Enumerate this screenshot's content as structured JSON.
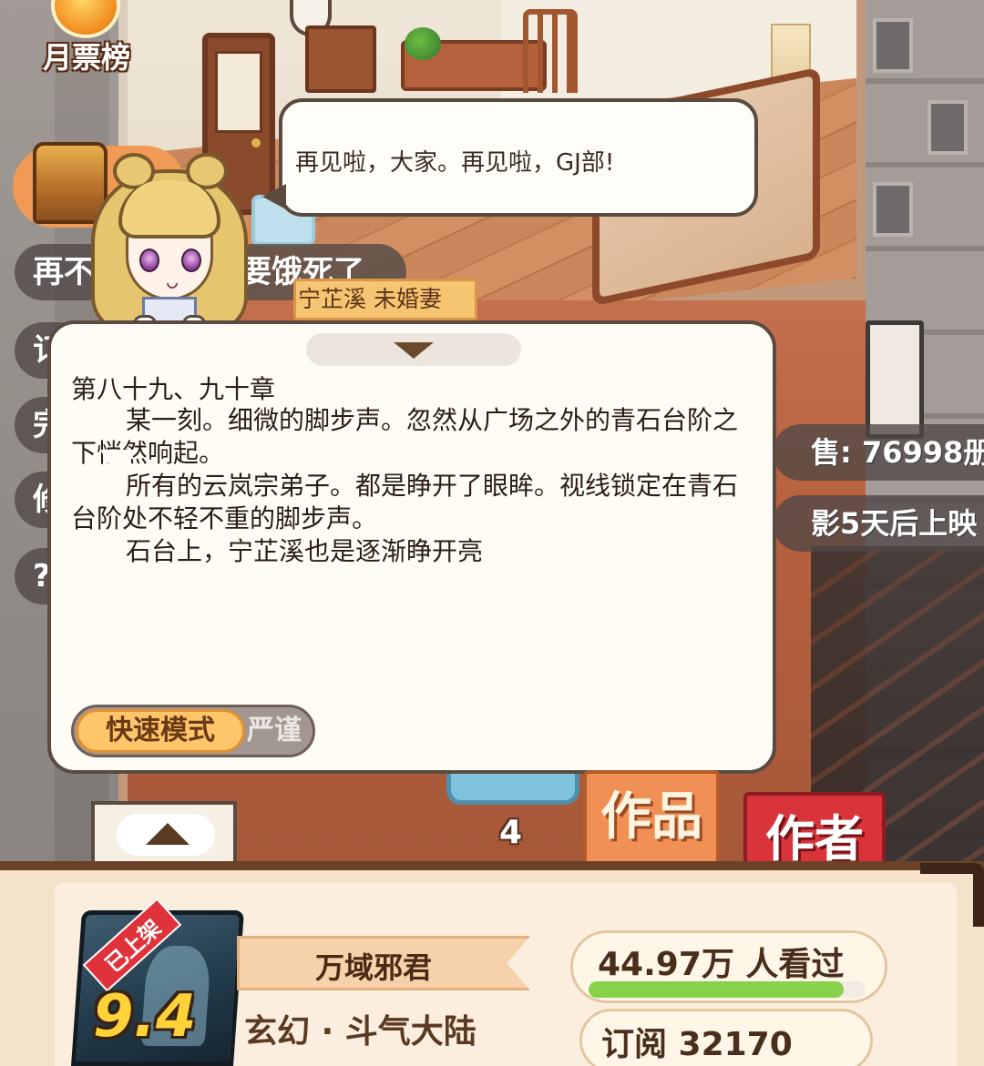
{
  "hud": {
    "monthly_rank_label": "月票榜",
    "left_pills": [
      "再不",
      "要饿死了",
      "订",
      "完",
      "修",
      "?"
    ],
    "right_pills": {
      "sales": "售: 76998册",
      "movie": "影5天后上映"
    }
  },
  "speech": {
    "text": "再见啦，大家。再见啦，GJ部!"
  },
  "name_tag": "宁芷溪  未婚妻",
  "reader": {
    "chapter_title": "第八十九、九十章",
    "paragraphs": [
      "某一刻。细微的脚步声。忽然从广场之外的青石台阶之下悄然响起。",
      "所有的云岚宗弟子。都是睁开了眼眸。视线锁定在青石台阶处不轻不重的脚步声。",
      "石台上，宁芷溪也是逐渐睁开亮"
    ],
    "mode_fast": "快速模式",
    "mode_strict": "严谨"
  },
  "floor_number": "4",
  "tabs": {
    "works": "作品",
    "author": "作者"
  },
  "book": {
    "status_ribbon": "已上架",
    "rating": "9.4",
    "title": "万域邪君",
    "genre": "玄幻 · 斗气大陆",
    "views": "44.97万 人看过",
    "views_progress": 0.92,
    "subscriptions": "订阅  32170"
  },
  "colors": {
    "accent_orange": "#f09055",
    "author_red": "#d9343b",
    "progress_green": "#86d24a",
    "panel_border": "#5a4a40"
  }
}
